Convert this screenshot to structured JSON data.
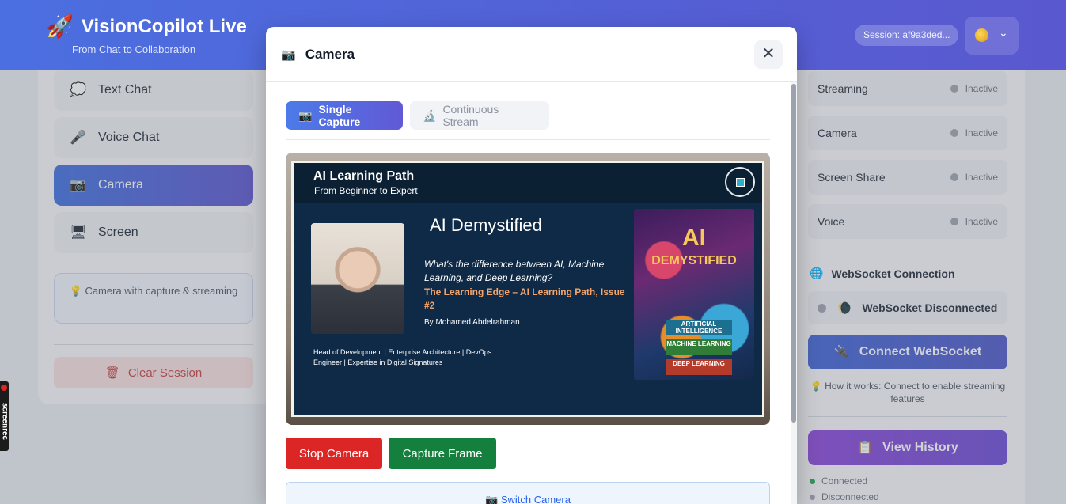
{
  "header": {
    "logo_icon": "rocket-icon",
    "title": "VisionCopilot Live",
    "subtitle": "From Chat to Collaboration",
    "session_label": "Session: af9a3ded...",
    "user_icon": "avatar-icon",
    "user_chevron": "⌄"
  },
  "sidebar": {
    "items": [
      {
        "label": "Text Chat",
        "icon": "💭"
      },
      {
        "label": "Voice Chat",
        "icon": "🎤"
      },
      {
        "label": "Camera",
        "icon": "📷"
      },
      {
        "label": "Screen",
        "icon": "🖥"
      }
    ],
    "info_icon": "💡",
    "info_text": "Camera with capture & streaming",
    "clear_icon": "🗑",
    "clear_label": "Clear Session"
  },
  "status_panel": {
    "rows": [
      {
        "label": "Streaming",
        "value": "Inactive"
      },
      {
        "label": "Camera",
        "value": "Inactive"
      },
      {
        "label": "Screen Share",
        "value": "Inactive"
      },
      {
        "label": "Voice",
        "value": "Inactive"
      }
    ],
    "ws_icon": "🌐",
    "ws_title": "WebSocket Connection",
    "ws_status_icon": "🌘",
    "ws_status": "WebSocket Disconnected",
    "connect_icon": "🔌",
    "connect_label": "Connect WebSocket",
    "how_icon": "💡",
    "how_text": "How it works: Connect to enable streaming features",
    "history_icon": "📋",
    "history_label": "View History",
    "legend": [
      {
        "label": "Connected",
        "color": "#22a559"
      },
      {
        "label": "Disconnected",
        "color": "#9ca3af"
      }
    ]
  },
  "screenrec": {
    "label": "screenrec"
  },
  "modal": {
    "icon": "📷",
    "title": "Camera",
    "close": "✕",
    "tabs": [
      {
        "icon": "📷",
        "label": "Single Capture"
      },
      {
        "icon": "🔬",
        "label": "Continuous Stream"
      }
    ],
    "slide": {
      "heading": "AI Learning Path",
      "subheading": "From Beginner to Expert",
      "title": "AI Demystified",
      "question": "What's the difference between AI, Machine Learning, and Deep Learning?",
      "series": "The Learning Edge – AI Learning Path, Issue #2",
      "byline": "By Mohamed Abdelrahman",
      "roles": "Head of Development | Enterprise Architecture | DevOps Engineer | Expertise in Digital Signatures",
      "book_ai": "AI",
      "book_title": "DEMYSTIFIED",
      "book_layers": [
        "ARTIFICIAL INTELLIGENCE",
        "MACHINE LEARNING",
        "DEEP LEARNING"
      ]
    },
    "stop_label": "Stop Camera",
    "capture_label": "Capture Frame",
    "switch_icon": "📷",
    "switch_label": "Switch Camera"
  }
}
